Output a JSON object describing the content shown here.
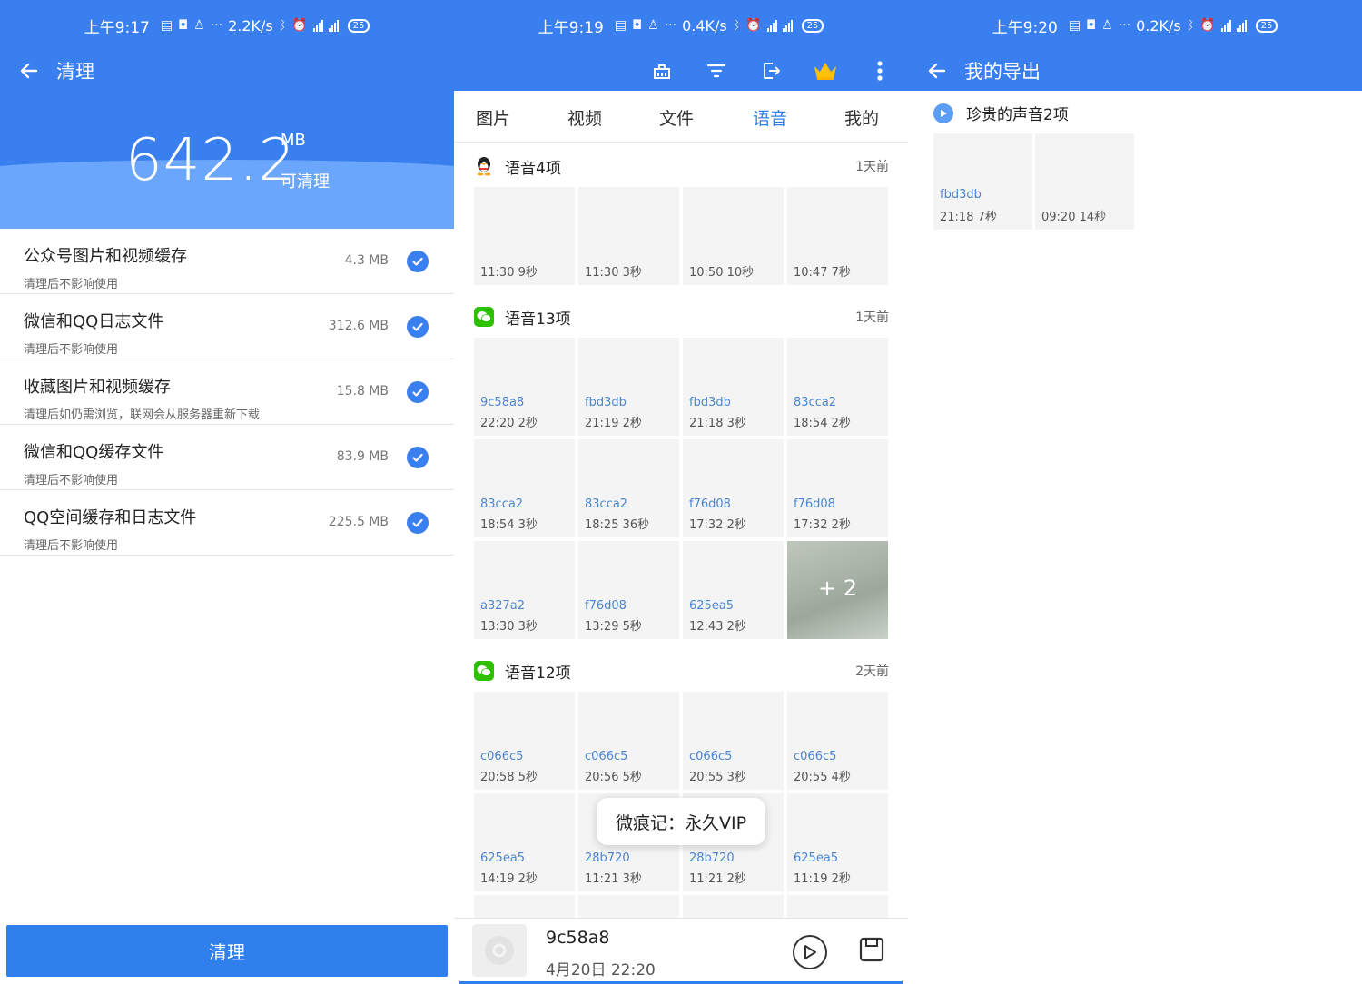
{
  "left": {
    "status": {
      "time": "上午9:17",
      "speed": "2.2K/s",
      "battery": "25"
    },
    "title": "清理",
    "hero": {
      "value": "642.2",
      "unit": "MB",
      "label": "可清理"
    },
    "items": [
      {
        "title": "公众号图片和视频缓存",
        "subtitle": "清理后不影响使用",
        "size": "4.3 MB"
      },
      {
        "title": "微信和QQ日志文件",
        "subtitle": "清理后不影响使用",
        "size": "312.6 MB"
      },
      {
        "title": "收藏图片和视频缓存",
        "subtitle": "清理后如仍需浏览，联网会从服务器重新下载",
        "size": "15.8 MB"
      },
      {
        "title": "微信和QQ缓存文件",
        "subtitle": "清理后不影响使用",
        "size": "83.9 MB"
      },
      {
        "title": "QQ空间缓存和日志文件",
        "subtitle": "清理后不影响使用",
        "size": "225.5 MB"
      }
    ],
    "clean_button": "清理"
  },
  "middle": {
    "status": {
      "time": "上午9:19",
      "speed": "0.4K/s",
      "battery": "25"
    },
    "tabs": [
      "图片",
      "视频",
      "文件",
      "语音",
      "我的"
    ],
    "active_tab": "语音",
    "groups": [
      {
        "app": "qq",
        "title": "语音4项",
        "time": "1天前",
        "tiles": [
          {
            "id": "",
            "meta": "11:30  9秒"
          },
          {
            "id": "",
            "meta": "11:30  3秒"
          },
          {
            "id": "",
            "meta": "10:50  10秒"
          },
          {
            "id": "",
            "meta": "10:47  7秒"
          }
        ]
      },
      {
        "app": "wechat",
        "title": "语音13项",
        "time": "1天前",
        "tiles": [
          {
            "id": "9c58a8",
            "meta": "22:20  2秒"
          },
          {
            "id": "fbd3db",
            "meta": "21:19  2秒"
          },
          {
            "id": "fbd3db",
            "meta": "21:18  3秒"
          },
          {
            "id": "83cca2",
            "meta": "18:54  2秒"
          },
          {
            "id": "83cca2",
            "meta": "18:54  3秒"
          },
          {
            "id": "83cca2",
            "meta": "18:25  36秒"
          },
          {
            "id": "f76d08",
            "meta": "17:32  2秒"
          },
          {
            "id": "f76d08",
            "meta": "17:32  2秒"
          },
          {
            "id": "a327a2",
            "meta": "13:30  3秒"
          },
          {
            "id": "f76d08",
            "meta": "13:29  5秒"
          },
          {
            "id": "625ea5",
            "meta": "12:43  2秒"
          }
        ],
        "more": "+ 2"
      },
      {
        "app": "wechat",
        "title": "语音12项",
        "time": "2天前",
        "tiles": [
          {
            "id": "c066c5",
            "meta": "20:58  5秒"
          },
          {
            "id": "c066c5",
            "meta": "20:56  5秒"
          },
          {
            "id": "c066c5",
            "meta": "20:55  3秒"
          },
          {
            "id": "c066c5",
            "meta": "20:55  4秒"
          },
          {
            "id": "625ea5",
            "meta": "14:19  2秒"
          },
          {
            "id": "28b720",
            "meta": "11:21  3秒"
          },
          {
            "id": "28b720",
            "meta": "11:21  2秒"
          },
          {
            "id": "625ea5",
            "meta": "11:19  2秒"
          }
        ]
      }
    ],
    "toast": "微痕记：永久VIP",
    "player": {
      "name": "9c58a8",
      "date": "4月20日  22:20"
    }
  },
  "right": {
    "status": {
      "time": "上午9:20",
      "speed": "0.2K/s",
      "battery": "25"
    },
    "title": "我的导出",
    "group_title": "珍贵的声音2项",
    "tiles": [
      {
        "id": "fbd3db",
        "meta": "21:18  7秒"
      },
      {
        "id": "",
        "meta": "09:20  14秒"
      }
    ]
  },
  "colors": {
    "primary": "#3a7ff0",
    "accent": "#2f80ec",
    "wave": "#6aa6fb",
    "tile_bg": "#f4f4f4",
    "link": "#4a86cf"
  }
}
